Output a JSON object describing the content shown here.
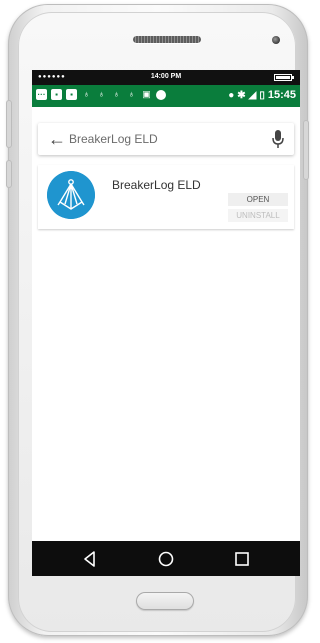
{
  "ios_status": {
    "carrier": "●●●●●●",
    "time": "14:00 PM"
  },
  "android_status": {
    "time": "15:45",
    "left_icons": [
      "message-icon",
      "sim-icon",
      "sim-icon",
      "bulb-icon",
      "bulb-icon",
      "bulb-icon",
      "bulb-icon",
      "image-icon",
      "record-dot-icon"
    ],
    "right_icons": [
      "location-icon",
      "bluetooth-icon",
      "signal-icon",
      "battery-icon"
    ]
  },
  "search": {
    "query": "BreakerLog ELD"
  },
  "app": {
    "name": "BreakerLog ELD",
    "open_label": "OPEN",
    "uninstall_label": "UNINSTALL",
    "icon_color": "#1f95cf"
  },
  "colors": {
    "status_bar": "#0a7d3c",
    "nav_bar": "#0d0d0d"
  }
}
